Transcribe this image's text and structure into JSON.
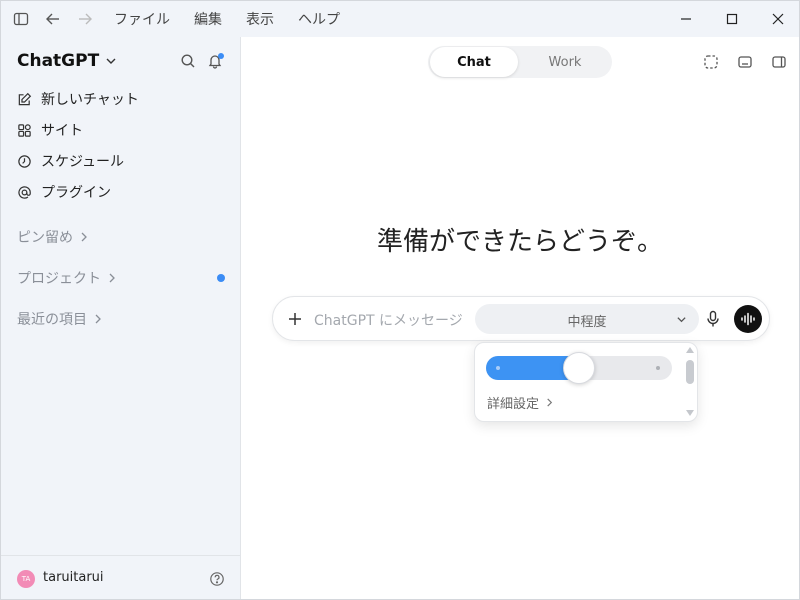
{
  "menu": [
    "ファイル",
    "編集",
    "表示",
    "ヘルプ"
  ],
  "sidebar": {
    "brand": "ChatGPT",
    "items": [
      {
        "label": "新しいチャット",
        "icon": "pencil-square-icon"
      },
      {
        "label": "サイト",
        "icon": "sites-grid-icon"
      },
      {
        "label": "スケジュール",
        "icon": "clock-icon"
      },
      {
        "label": "プラグイン",
        "icon": "at-sign-icon"
      }
    ],
    "sections": [
      "ピン留め",
      "プロジェクト",
      "最近の項目"
    ],
    "user": {
      "initials": "TA",
      "name": "taruitarui"
    }
  },
  "main": {
    "tabs": [
      {
        "label": "Chat",
        "active": true
      },
      {
        "label": "Work",
        "active": false
      }
    ],
    "hero": "準備ができたらどうぞ。",
    "composer": {
      "placeholder": "ChatGPT にメッセージ",
      "effort_label": "中程度"
    },
    "popover": {
      "slider_level": 0.5,
      "advanced_label": "詳細設定"
    }
  },
  "colors": {
    "accent": "#3d93f3",
    "notification_dot": "#3b8cf5",
    "avatar": "#f28bb6"
  }
}
